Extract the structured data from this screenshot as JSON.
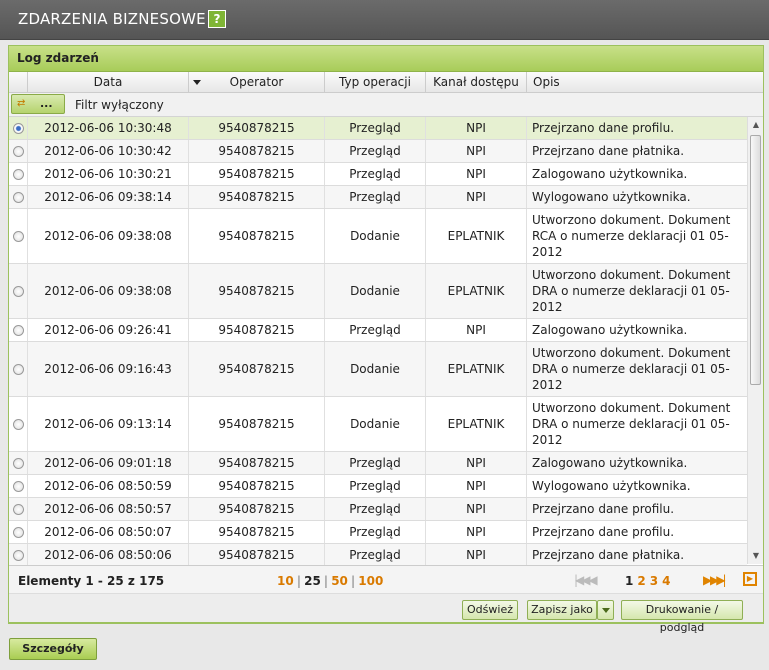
{
  "header": {
    "title": "ZDARZENIA BIZNESOWE",
    "help": "?"
  },
  "panel": {
    "title": "Log zdarzeń"
  },
  "columns": [
    "Data",
    "Operator",
    "Typ operacji",
    "Kanał dostępu",
    "Opis"
  ],
  "filter": {
    "button_label": "...",
    "status": "Filtr wyłączony"
  },
  "rows": [
    {
      "date": "2012-06-06 10:30:48",
      "operator": "9540878215",
      "type": "Przegląd",
      "channel": "NPI",
      "desc": "Przejrzano dane profilu.",
      "selected": true
    },
    {
      "date": "2012-06-06 10:30:42",
      "operator": "9540878215",
      "type": "Przegląd",
      "channel": "NPI",
      "desc": "Przejrzano dane płatnika."
    },
    {
      "date": "2012-06-06 10:30:21",
      "operator": "9540878215",
      "type": "Przegląd",
      "channel": "NPI",
      "desc": "Zalogowano użytkownika."
    },
    {
      "date": "2012-06-06 09:38:14",
      "operator": "9540878215",
      "type": "Przegląd",
      "channel": "NPI",
      "desc": "Wylogowano użytkownika."
    },
    {
      "date": "2012-06-06 09:38:08",
      "operator": "9540878215",
      "type": "Dodanie",
      "channel": "EPLATNIK",
      "desc": "Utworzono dokument. Dokument RCA o numerze deklaracji 01 05-2012"
    },
    {
      "date": "2012-06-06 09:38:08",
      "operator": "9540878215",
      "type": "Dodanie",
      "channel": "EPLATNIK",
      "desc": "Utworzono dokument. Dokument DRA o numerze deklaracji 01 05-2012"
    },
    {
      "date": "2012-06-06 09:26:41",
      "operator": "9540878215",
      "type": "Przegląd",
      "channel": "NPI",
      "desc": "Zalogowano użytkownika."
    },
    {
      "date": "2012-06-06 09:16:43",
      "operator": "9540878215",
      "type": "Dodanie",
      "channel": "EPLATNIK",
      "desc": "Utworzono dokument. Dokument DRA o numerze deklaracji 01 05-2012"
    },
    {
      "date": "2012-06-06 09:13:14",
      "operator": "9540878215",
      "type": "Dodanie",
      "channel": "EPLATNIK",
      "desc": "Utworzono dokument. Dokument DRA o numerze deklaracji 01 05-2012"
    },
    {
      "date": "2012-06-06 09:01:18",
      "operator": "9540878215",
      "type": "Przegląd",
      "channel": "NPI",
      "desc": "Zalogowano użytkownika."
    },
    {
      "date": "2012-06-06 08:50:59",
      "operator": "9540878215",
      "type": "Przegląd",
      "channel": "NPI",
      "desc": "Wylogowano użytkownika."
    },
    {
      "date": "2012-06-06 08:50:57",
      "operator": "9540878215",
      "type": "Przegląd",
      "channel": "NPI",
      "desc": "Przejrzano dane profilu."
    },
    {
      "date": "2012-06-06 08:50:07",
      "operator": "9540878215",
      "type": "Przegląd",
      "channel": "NPI",
      "desc": "Przejrzano dane profilu."
    },
    {
      "date": "2012-06-06 08:50:06",
      "operator": "9540878215",
      "type": "Przegląd",
      "channel": "NPI",
      "desc": "Przejrzano dane płatnika."
    }
  ],
  "pager": {
    "count": "Elementy 1 - 25 z 175",
    "sizes": [
      "10",
      "25",
      "50",
      "100"
    ],
    "current_size": "25",
    "pages": [
      "1",
      "2",
      "3",
      "4"
    ],
    "current_page": "1"
  },
  "actions": {
    "refresh": "Odśwież",
    "save_as": "Zapisz jako",
    "print": "Drukowanie / podgląd"
  },
  "details_button": "Szczegóły",
  "icons": {
    "help": "help-icon",
    "filter": "filter-icon",
    "sort": "sort-desc-icon",
    "radio": "radio-icon"
  },
  "colors": {
    "accent": "#a8cc59",
    "link": "#d97a00",
    "header_bg": "#5f5f5f"
  }
}
